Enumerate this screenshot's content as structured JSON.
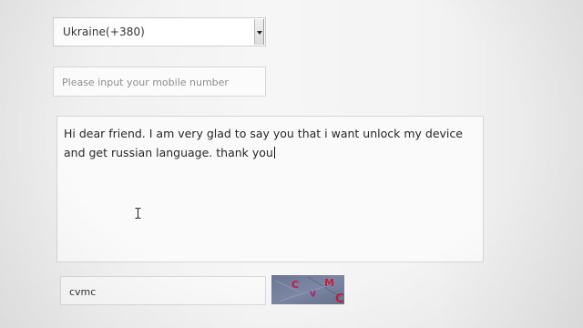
{
  "form": {
    "country_select": {
      "value": "Ukraine(+380)",
      "icon": "chevron-down-icon"
    },
    "phone": {
      "value": "",
      "placeholder": "Please input your mobile number"
    },
    "message": {
      "value": "Hi dear friend. I am very glad to say you that i want unlock my device and get russian language. thank you"
    },
    "captcha": {
      "input_value": "cvmc",
      "image_text": "CVMC"
    }
  },
  "colors": {
    "page_background": "#f3f3f3",
    "field_border": "#d8d8d8",
    "captcha_background": "#74809a",
    "captcha_letter": "#d11a45"
  }
}
